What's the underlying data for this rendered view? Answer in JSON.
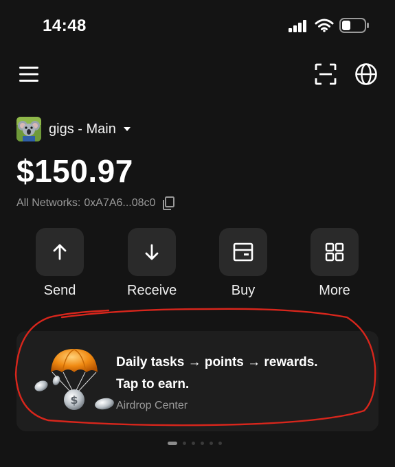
{
  "status_bar": {
    "time": "14:48"
  },
  "account": {
    "name": "gigs - Main",
    "balance": "$150.97"
  },
  "address": {
    "label": "All Networks:",
    "value": "0xA7A6...08c0"
  },
  "actions": [
    {
      "label": "Send",
      "icon": "arrow-up-icon"
    },
    {
      "label": "Receive",
      "icon": "arrow-down-icon"
    },
    {
      "label": "Buy",
      "icon": "wallet-card-icon"
    },
    {
      "label": "More",
      "icon": "grid-icon"
    }
  ],
  "promo": {
    "headline_line1": "Daily tasks → points → rewards.",
    "headline_line2": "Tap to earn.",
    "subtitle": "Airdrop Center"
  },
  "pager": {
    "count": 6,
    "active_index": 0
  },
  "colors": {
    "background": "#141414",
    "tile": "#2a2a2a",
    "card": "#1e1e1e",
    "annotation": "#d8261c",
    "muted_text": "#9a9a9a"
  }
}
